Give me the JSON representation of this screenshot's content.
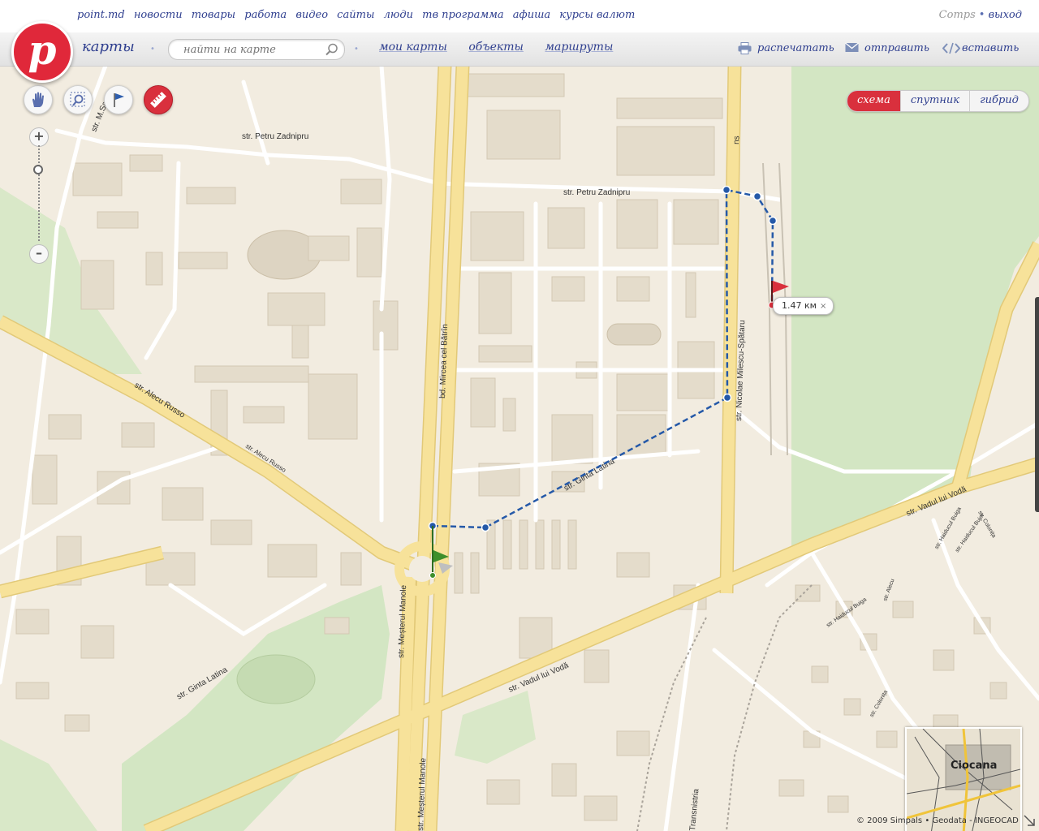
{
  "top_nav": {
    "links": [
      "point.md",
      "новости",
      "товары",
      "работа",
      "видео",
      "сайты",
      "люди",
      "тв программа",
      "афиша",
      "курсы валют"
    ],
    "user": "Comps",
    "logout": "выход"
  },
  "header": {
    "logo": "p",
    "section_title": "карты",
    "search_placeholder": "найти на карте",
    "nav": [
      "мои карты",
      "объекты",
      "маршруты"
    ],
    "actions": {
      "print": "распечатать",
      "send": "отправить",
      "embed": "вставить"
    }
  },
  "map": {
    "map_types": [
      "схема",
      "спутник",
      "гибрид"
    ],
    "selected_type": "схема",
    "tools": [
      "hand-icon",
      "zoom-area-icon",
      "flag-icon",
      "ruler-icon"
    ],
    "active_tool": "ruler-icon",
    "zoom_in": "+",
    "zoom_out": "–",
    "distance_label": "1.47 км",
    "distance_close": "×",
    "minimap_label": "Ciocana",
    "copyright": "© 2009 Simpals • Geodata - INGEOCAD",
    "street_labels": {
      "petru_zadnipru_1": "str. Petru Zadnipru",
      "petru_zadnipru_2": "str. Petru Zadnipru",
      "msa": "str. M.Sa",
      "alecu_russo_main": "str. Alecu Russo",
      "alecu_russo_small": "str. Alecu Russo",
      "mircea_cel_batrin": "bd. Mircea cel Bătrîn",
      "ginta_latina_1": "str. Ginta Latina",
      "ginta_latina_2": "str. Ginta Latina",
      "milescu_spataru": "str. Nicolae Milescu-Spătaru",
      "vadul_lui_voda_1": "str. Vadul lui Vodă",
      "vadul_lui_voda_2": "str. Vadul lui Vodă",
      "mesterul_manole_1": "str. Meșterul Manole",
      "mesterul_manole_2": "str. Meșterul Manole",
      "transnistria": "Transnistria",
      "ns": "ns",
      "haiducul_buiga_1": "str. Haiducul Buiga",
      "haiducul_buiga_2": "str. Haiducul Buiga",
      "haiducul_bujor": "str. Haiducul Bujor",
      "colonita_1": "str. Colonița",
      "colonita_2": "str. Colonița",
      "alecu": "str. Alecu"
    },
    "colors": {
      "background": "#f2ece0",
      "major_road": "#f7e29a",
      "park": "#d3e6c3",
      "route": "#2559a8",
      "accent": "#d9303d"
    }
  }
}
